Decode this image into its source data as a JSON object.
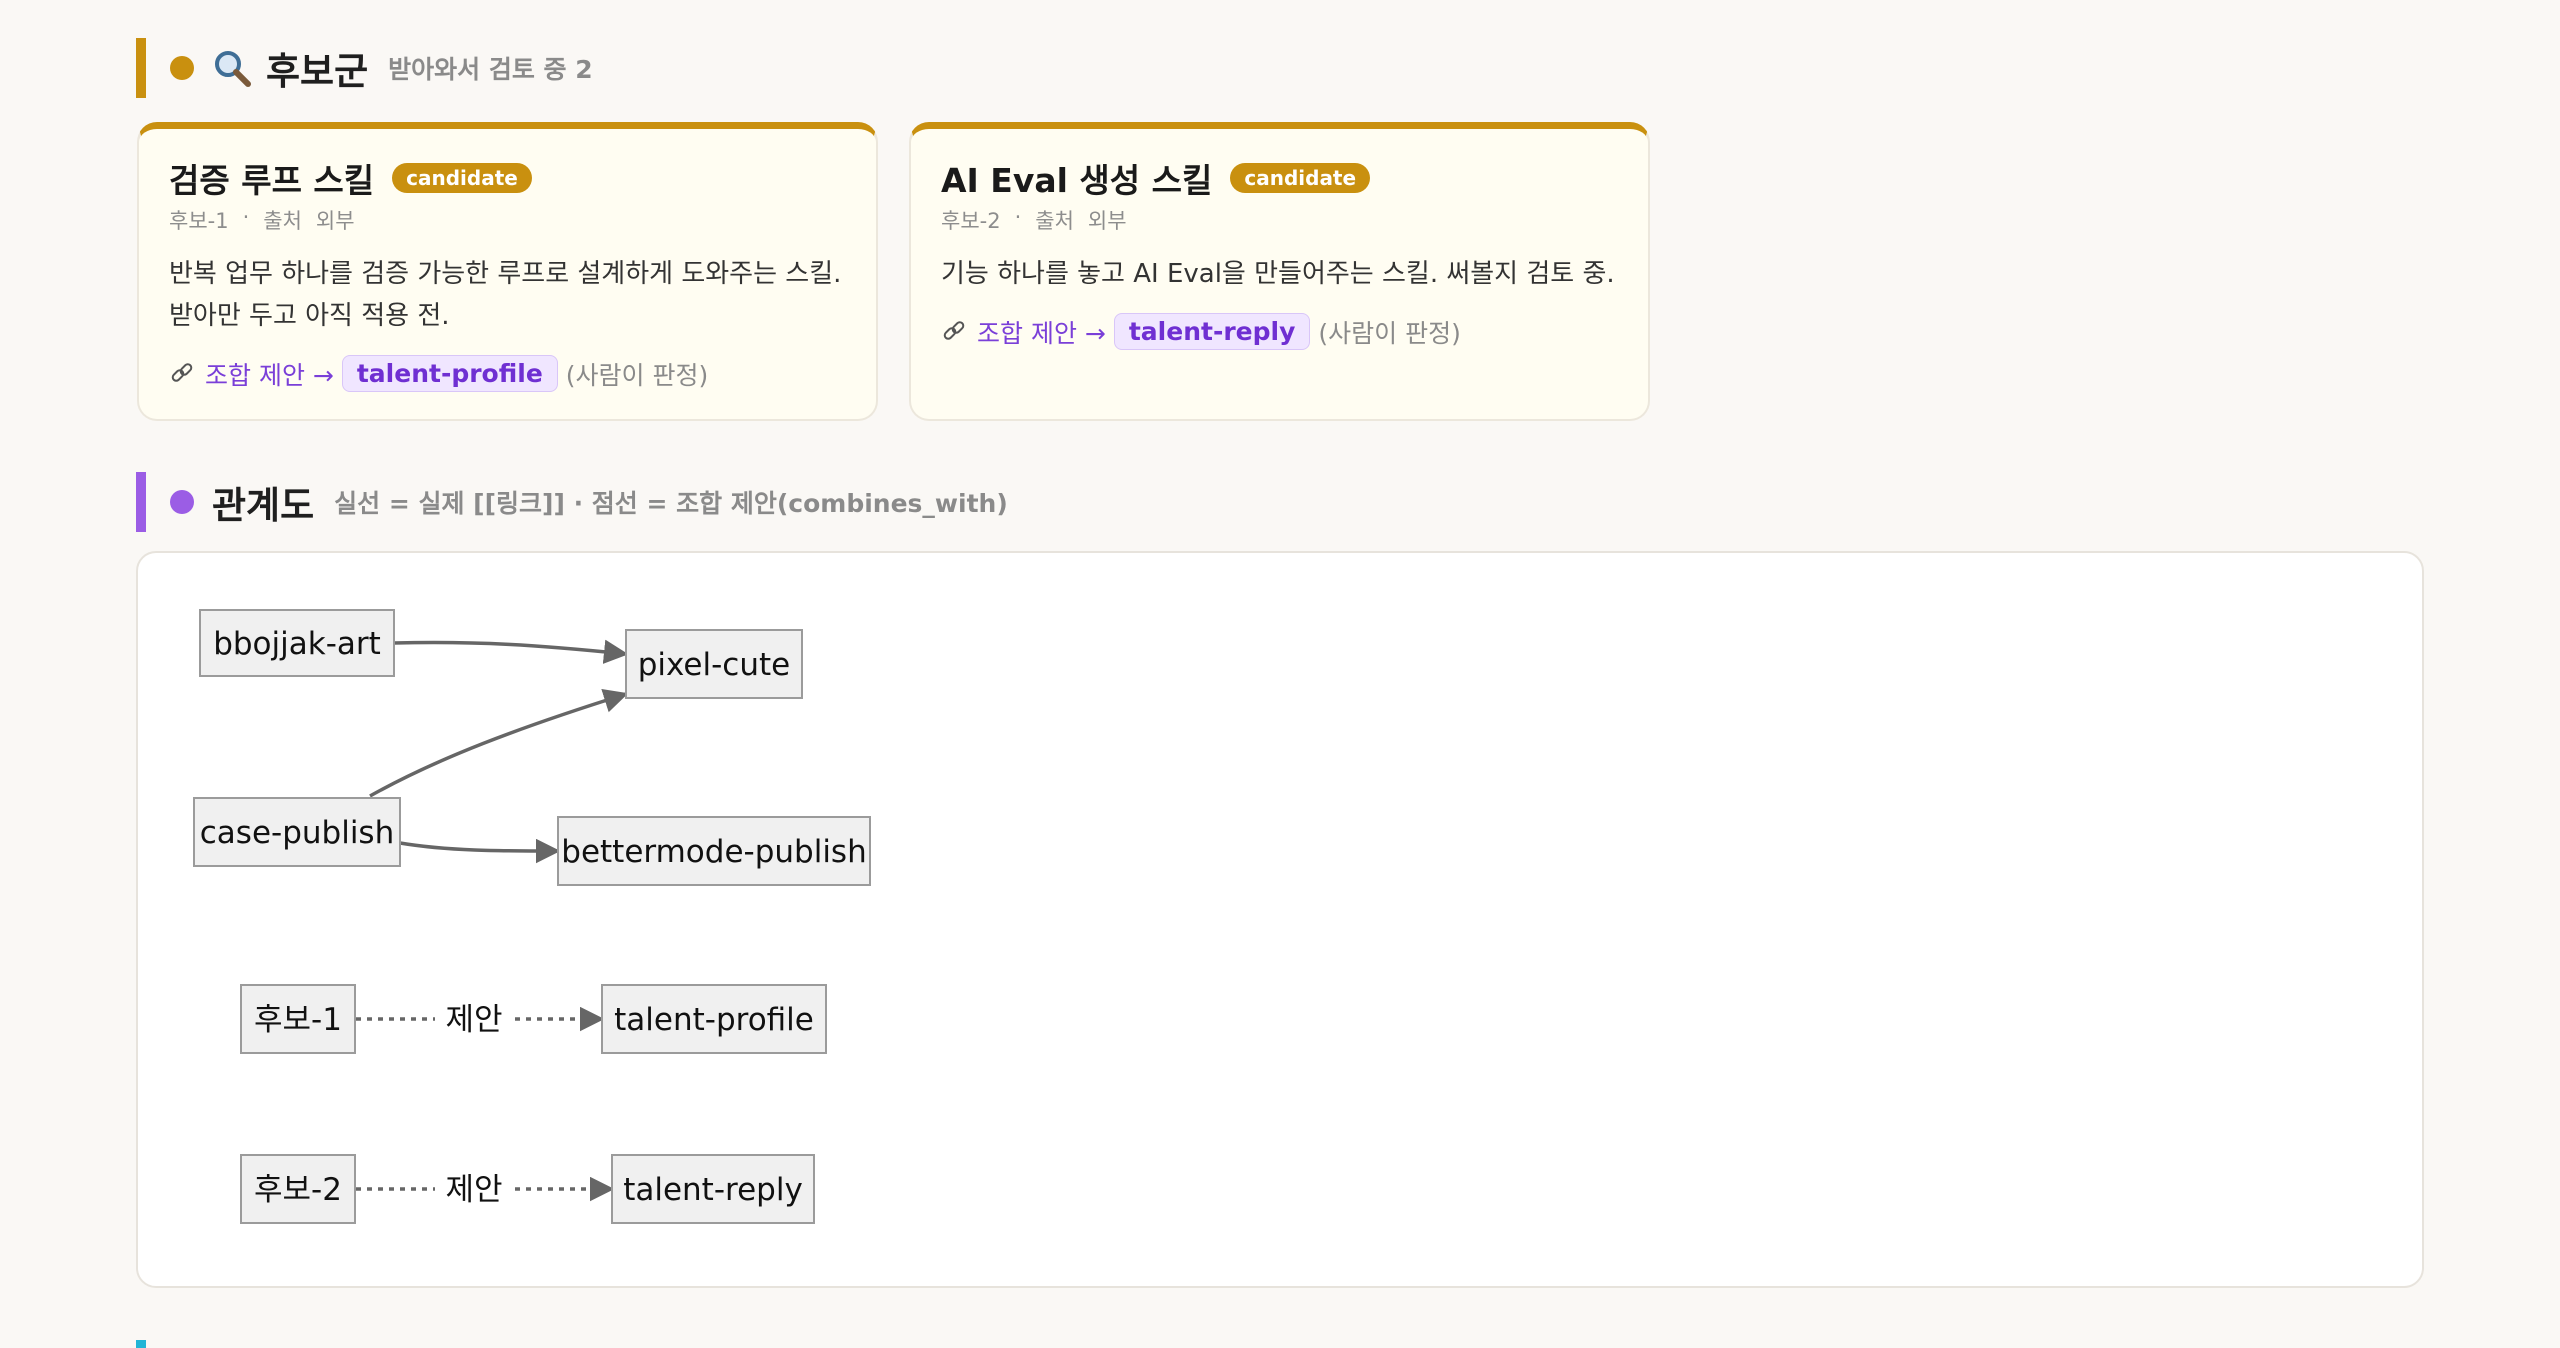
{
  "candidates_section": {
    "title": "후보군",
    "subtitle": "받아와서 검토 중 2",
    "icon": "magnifier-icon",
    "accent": "#c9900f"
  },
  "cards": [
    {
      "title": "검증 루프 스킬",
      "badge": "candidate",
      "id": "후보-1",
      "source_label": "출처",
      "source_value": "외부",
      "description": "반복 업무 하나를 검증 가능한 루프로 설계하게 도와주는 스킬. 받아만 두고 아직 적용 전.",
      "link_text": "조합 제안 →",
      "skill": "talent-profile",
      "judge": "(사람이 판정)"
    },
    {
      "title": "AI Eval 생성 스킬",
      "badge": "candidate",
      "id": "후보-2",
      "source_label": "출처",
      "source_value": "외부",
      "description": "기능 하나를 놓고 AI Eval을 만들어주는 스킬. 써볼지 검토 중.",
      "link_text": "조합 제안 →",
      "skill": "talent-reply",
      "judge": "(사람이 판정)"
    }
  ],
  "graph_section": {
    "title": "관계도",
    "subtitle": "실선 = 실제 [[링크]] · 점선 = 조합 제안(combines_with)",
    "accent": "#9b5de5"
  },
  "graph": {
    "nodes": {
      "bbojjak": "bbojjak-art",
      "pixel": "pixel-cute",
      "case": "case-publish",
      "better": "bettermode-publish",
      "c1": "후보-1",
      "tprofile": "talent-profile",
      "c2": "후보-2",
      "treply": "talent-reply"
    },
    "edge_label": "제안"
  }
}
